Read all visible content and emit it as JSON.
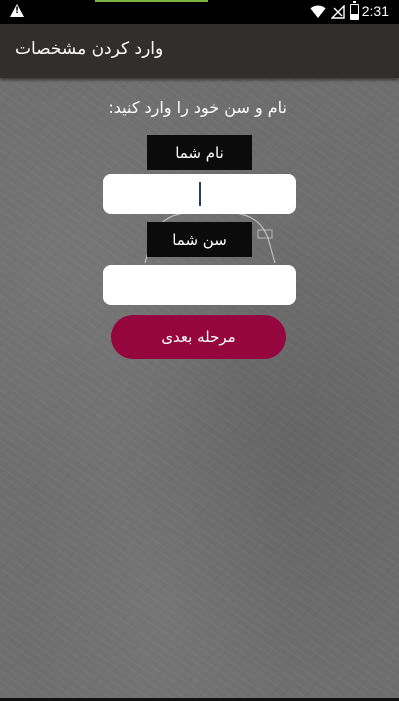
{
  "status_bar": {
    "time": "2:31",
    "icons": [
      "warning-icon",
      "wifi-icon",
      "no-signal-icon",
      "battery-icon"
    ]
  },
  "app_bar": {
    "title": "وارد کردن مشخصات"
  },
  "form": {
    "prompt": "نام و سن خود را وارد کنید:",
    "name_label": "نام شما",
    "name_value": "",
    "age_label": "سن شما",
    "age_value": "",
    "next_button_label": "مرحله بعدی"
  },
  "colors": {
    "app_bar": "#332e2e",
    "button": "#95063e",
    "background": "#6e6e6e"
  }
}
